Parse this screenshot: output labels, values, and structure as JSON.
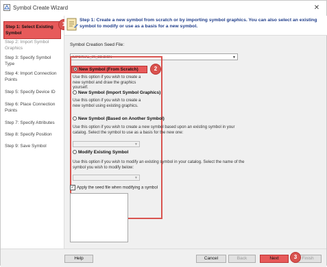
{
  "window": {
    "title": "Symbol Create Wizard",
    "close_glyph": "✕"
  },
  "header": {
    "instruction": "Step 1: Create a new symbol from scratch or by importing symbol graphics. You can also select an existing symbol to modify or use as a basis for a new symbol."
  },
  "sidebar": {
    "steps": [
      {
        "label": "Step 1: Select Existing Symbol",
        "state": "active"
      },
      {
        "label": "Step 2: Import Symbol Graphics",
        "state": "disabled"
      },
      {
        "label": "Step 3: Specify Symbol Type",
        "state": "normal"
      },
      {
        "label": "Step 4: Import Connection Points",
        "state": "normal"
      },
      {
        "label": "Step 5: Specify Device ID",
        "state": "normal"
      },
      {
        "label": "Step 6: Place Connection Points",
        "state": "normal"
      },
      {
        "label": "Step 7: Specify Attributes",
        "state": "normal"
      },
      {
        "label": "Step 8: Specify Position",
        "state": "normal"
      },
      {
        "label": "Step 9: Save Symbol",
        "state": "normal"
      }
    ]
  },
  "form": {
    "seed_label": "Symbol Creation Seed File:",
    "seed_value": "IMPERIAL_IR_3D.DGN",
    "options": [
      {
        "label": "New Symbol (From Scratch)",
        "checked": true,
        "description": "Use this option if you wish to create a new symbol and draw the graphics yourself."
      },
      {
        "label": "New Symbol (Import Symbol Graphics)",
        "checked": false,
        "description": "Use this option if you wish to create a new symbol using existing graphics."
      },
      {
        "label": "New Symbol (Based on Another Symbol)",
        "checked": false,
        "description": "Use this option if you wish to create a new symbol based upon an existing symbol in your catalog. Select the symbol to use as a basis for the new one:"
      },
      {
        "label": "Modify Existing Symbol",
        "checked": false,
        "description": "Use this option if you wish to modify an existing symbol in your catalog. Select the name of the symbol you wish to modify below:"
      }
    ],
    "apply_seed_label": "Apply the seed file when modifying a symbol",
    "apply_seed_checked": true
  },
  "footer": {
    "help": "Help",
    "cancel": "Cancel",
    "back": "Back",
    "next": "Next",
    "finish": "Finish"
  },
  "callouts": [
    "1",
    "2",
    "3"
  ],
  "colors": {
    "highlight": "#e75a5a",
    "header_text": "#1f3d8a"
  }
}
